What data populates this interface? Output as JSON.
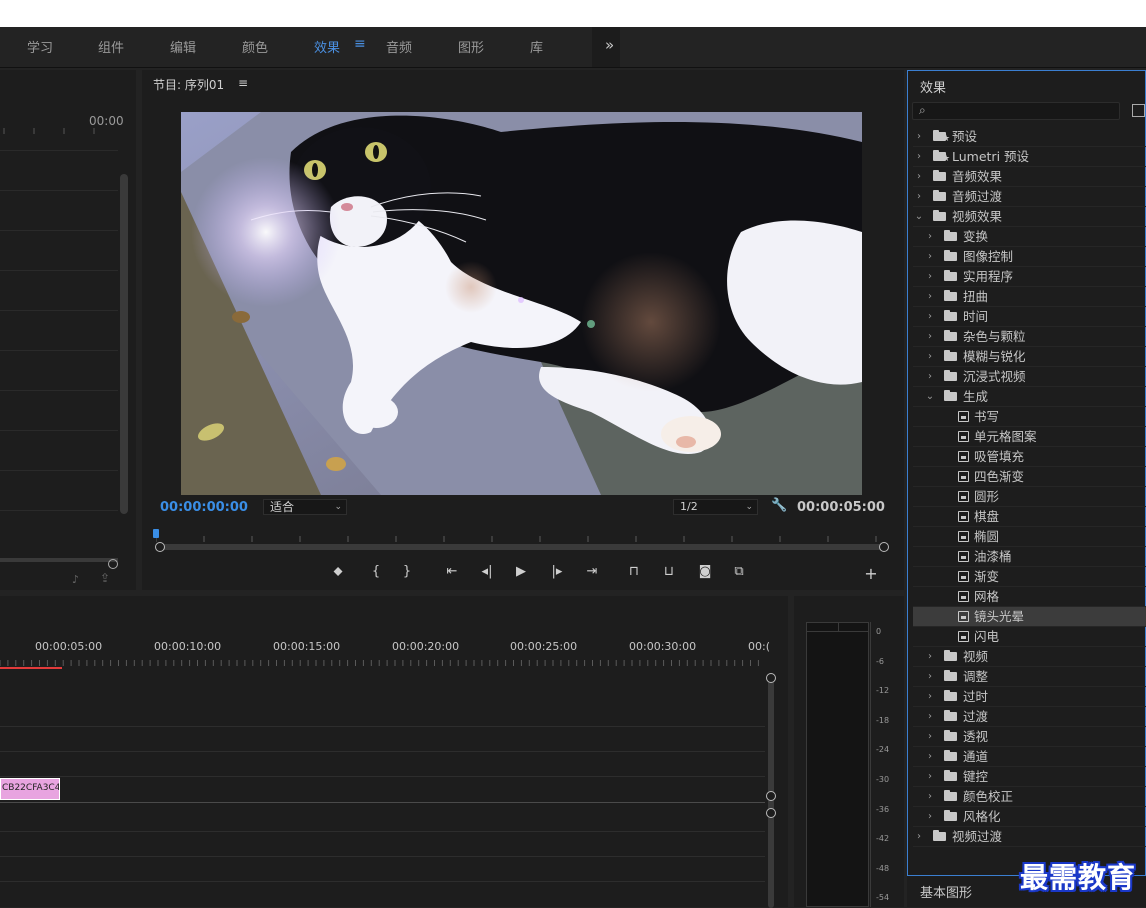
{
  "workspaces": {
    "tabs": [
      {
        "label": "学习"
      },
      {
        "label": "组件"
      },
      {
        "label": "编辑"
      },
      {
        "label": "颜色"
      },
      {
        "label": "效果"
      },
      {
        "label": "音频"
      },
      {
        "label": "图形"
      },
      {
        "label": "库"
      }
    ],
    "active": "效果",
    "overflow_icon": "»"
  },
  "source_panel": {
    "timecode": "00:00"
  },
  "program": {
    "title": "节目: 序列01",
    "menu_icon": "≡",
    "current_time": "00:00:00:00",
    "fit": "适合",
    "resolution": "1/2",
    "duration": "00:00:05:00"
  },
  "controls": [
    {
      "name": "add-marker",
      "glyph": "⬥"
    },
    {
      "name": "mark-in",
      "glyph": "{"
    },
    {
      "name": "mark-out",
      "glyph": "}"
    },
    {
      "name": "go-to-in",
      "glyph": "⇤"
    },
    {
      "name": "step-back",
      "glyph": "◂|"
    },
    {
      "name": "play",
      "glyph": "▶"
    },
    {
      "name": "step-forward",
      "glyph": "|▸"
    },
    {
      "name": "go-to-out",
      "glyph": "⇥"
    },
    {
      "name": "lift",
      "glyph": "⊓"
    },
    {
      "name": "extract",
      "glyph": "⊔"
    },
    {
      "name": "export-frame",
      "glyph": "◙"
    },
    {
      "name": "comparison-view",
      "glyph": "⧉"
    }
  ],
  "add_button": "+",
  "effects": {
    "title": "效果",
    "search_placeholder": "",
    "items": [
      {
        "label": "预设",
        "level": 0,
        "type": "preset",
        "expanded": false
      },
      {
        "label": "Lumetri 预设",
        "level": 0,
        "type": "preset",
        "expanded": false
      },
      {
        "label": "音频效果",
        "level": 0,
        "type": "folder",
        "expanded": false
      },
      {
        "label": "音频过渡",
        "level": 0,
        "type": "folder",
        "expanded": false
      },
      {
        "label": "视频效果",
        "level": 0,
        "type": "folder",
        "expanded": true
      },
      {
        "label": "变换",
        "level": 1,
        "type": "folder",
        "expanded": false
      },
      {
        "label": "图像控制",
        "level": 1,
        "type": "folder",
        "expanded": false
      },
      {
        "label": "实用程序",
        "level": 1,
        "type": "folder",
        "expanded": false
      },
      {
        "label": "扭曲",
        "level": 1,
        "type": "folder",
        "expanded": false
      },
      {
        "label": "时间",
        "level": 1,
        "type": "folder",
        "expanded": false
      },
      {
        "label": "杂色与颗粒",
        "level": 1,
        "type": "folder",
        "expanded": false
      },
      {
        "label": "模糊与锐化",
        "level": 1,
        "type": "folder",
        "expanded": false
      },
      {
        "label": "沉浸式视频",
        "level": 1,
        "type": "folder",
        "expanded": false
      },
      {
        "label": "生成",
        "level": 1,
        "type": "folder",
        "expanded": true
      },
      {
        "label": "书写",
        "level": 2,
        "type": "effect"
      },
      {
        "label": "单元格图案",
        "level": 2,
        "type": "effect"
      },
      {
        "label": "吸管填充",
        "level": 2,
        "type": "effect"
      },
      {
        "label": "四色渐变",
        "level": 2,
        "type": "effect"
      },
      {
        "label": "圆形",
        "level": 2,
        "type": "effect"
      },
      {
        "label": "棋盘",
        "level": 2,
        "type": "effect"
      },
      {
        "label": "椭圆",
        "level": 2,
        "type": "effect"
      },
      {
        "label": "油漆桶",
        "level": 2,
        "type": "effect"
      },
      {
        "label": "渐变",
        "level": 2,
        "type": "effect"
      },
      {
        "label": "网格",
        "level": 2,
        "type": "effect"
      },
      {
        "label": "镜头光晕",
        "level": 2,
        "type": "effect",
        "selected": true
      },
      {
        "label": "闪电",
        "level": 2,
        "type": "effect"
      },
      {
        "label": "视频",
        "level": 1,
        "type": "folder",
        "expanded": false
      },
      {
        "label": "调整",
        "level": 1,
        "type": "folder",
        "expanded": false
      },
      {
        "label": "过时",
        "level": 1,
        "type": "folder",
        "expanded": false
      },
      {
        "label": "过渡",
        "level": 1,
        "type": "folder",
        "expanded": false
      },
      {
        "label": "透视",
        "level": 1,
        "type": "folder",
        "expanded": false
      },
      {
        "label": "通道",
        "level": 1,
        "type": "folder",
        "expanded": false
      },
      {
        "label": "键控",
        "level": 1,
        "type": "folder",
        "expanded": false
      },
      {
        "label": "颜色校正",
        "level": 1,
        "type": "folder",
        "expanded": false
      },
      {
        "label": "风格化",
        "level": 1,
        "type": "folder",
        "expanded": false
      },
      {
        "label": "视频过渡",
        "level": 0,
        "type": "folder",
        "expanded": false
      }
    ]
  },
  "basic_graphics": {
    "title": "基本图形"
  },
  "watermark": "最需教育",
  "timeline": {
    "ruler_labels": [
      "00:00:05:00",
      "00:00:10:00",
      "00:00:15:00",
      "00:00:20:00",
      "00:00:25:00",
      "00:00:30:00",
      "00:("
    ],
    "clip_label": "CB22CFA3C4"
  },
  "audio_meter": {
    "db_ticks": [
      "0",
      "-6",
      "-12",
      "-18",
      "-24",
      "-30",
      "-36",
      "-42",
      "-48",
      "-54"
    ]
  },
  "colors": {
    "accent": "#3a8ee6",
    "playhead": "#e23b3b",
    "clip": "#e8a4e0"
  }
}
